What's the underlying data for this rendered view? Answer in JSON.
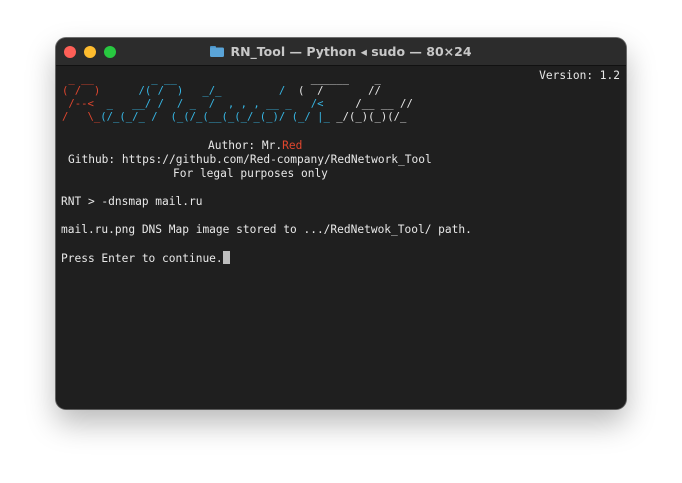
{
  "window": {
    "title": "RN_Tool — Python ◂ sudo — 80×24",
    "title_icon": "folder-icon",
    "controls": [
      "close-button",
      "minimize-button",
      "zoom-button"
    ]
  },
  "terminal": {
    "version": "Version: 1.2",
    "banner": [
      {
        "red": " _ __ ",
        "cyan": "        _ __      ",
        "cyan2": "           ",
        "white": "    ______    _ "
      },
      {
        "red": "( /  )",
        "cyan": "      /( /  )   _/_",
        "cyan2": "         /  ",
        "white": "(  /       //"
      },
      {
        "red": " /--< ",
        "cyan": " _   __/ /  / _  /  , , , __ _   /<  ",
        "cyan2": "",
        "white": "   /__ __ //"
      },
      {
        "red": "/   \\_",
        "cyan": "(/_(_/_ /  (_(/_(__(_(_/_(_)/ (_/ |_",
        "cyan2": "",
        "white": " _/(_)(_)(/_"
      }
    ],
    "author_prefix": "Author: Mr.",
    "author_name": "Red",
    "github": "Github: https://github.com/Red-company/RedNetwork_Tool",
    "legal": "For legal purposes only",
    "command": "RNT > -dnsmap mail.ru",
    "output": "mail.ru.png DNS Map image stored to .../RedNetwok_Tool/ path.",
    "prompt": "Press Enter to continue."
  },
  "colors": {
    "red_accent": "#e0462e",
    "cyan_accent": "#37b7e5",
    "terminal_bg": "#1f1f1f",
    "text": "#e8e8e8"
  }
}
